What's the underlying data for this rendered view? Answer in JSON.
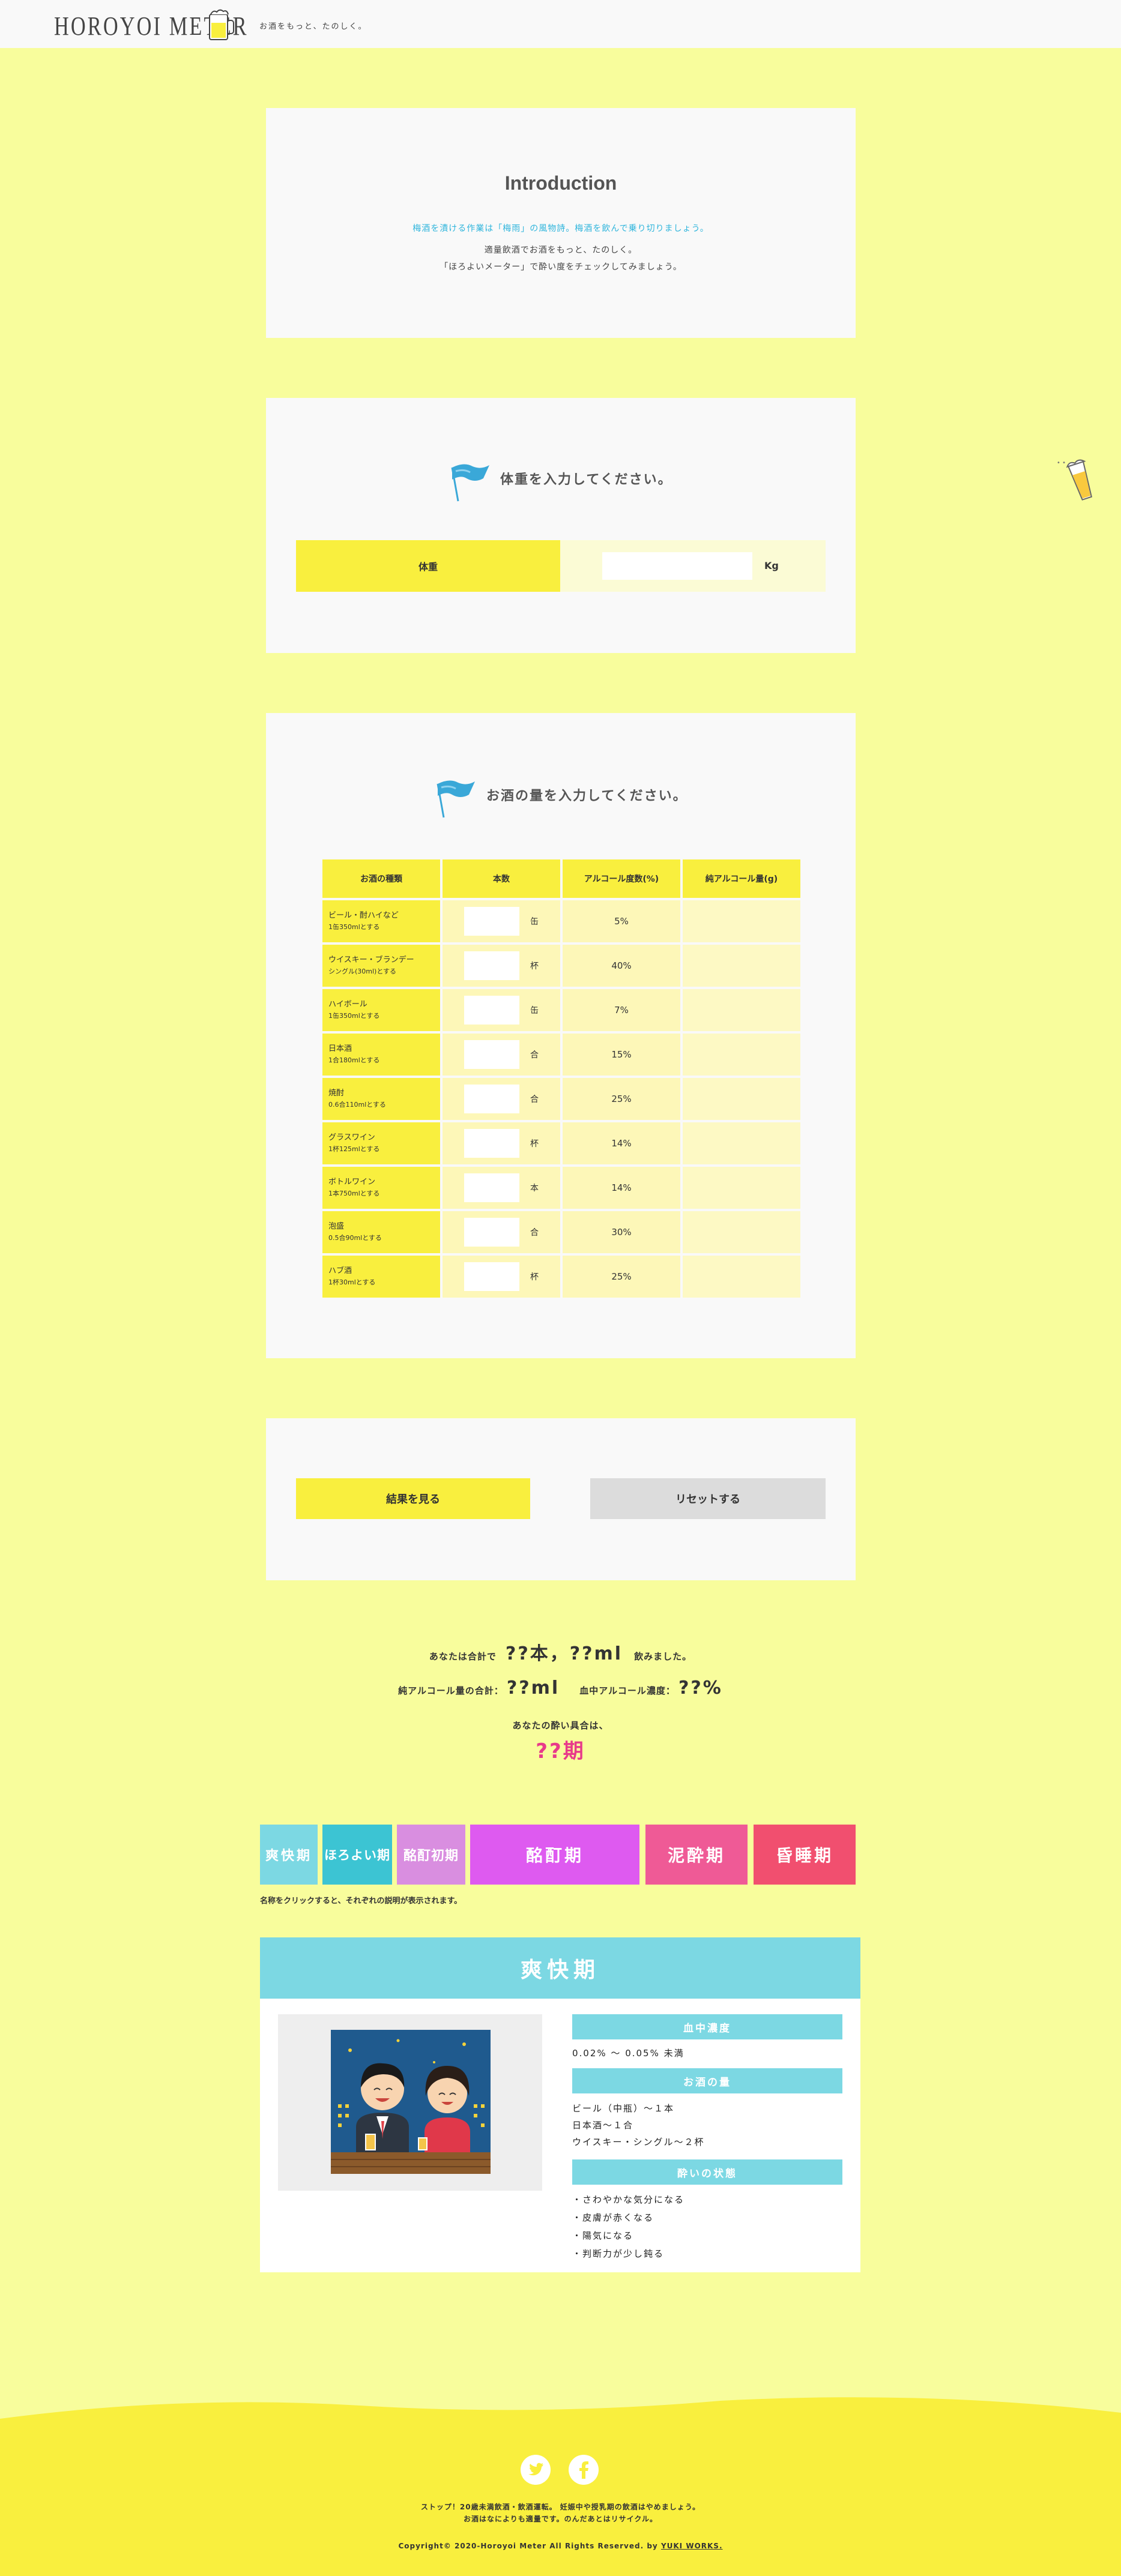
{
  "header": {
    "logo": "HOROYOI METER",
    "tagline": "お酒をもっと、たのしく。"
  },
  "intro": {
    "title": "Introduction",
    "lead": "梅酒を漬ける作業は「梅雨」の風物詩。梅酒を飲んで乗り切りましょう。",
    "body1": "適量飲酒でお酒をもっと、たのしく。",
    "body2": "「ほろよいメーター」で酔い度をチェックしてみましょう。"
  },
  "weight": {
    "heading": "体重を入力してください。",
    "label": "体重",
    "value": "",
    "unit": "Kg"
  },
  "drinks": {
    "heading": "お酒の量を入力してください。",
    "headers": [
      "お酒の種類",
      "本数",
      "アルコール度数(%)",
      "純アルコール量(g)"
    ],
    "rows": [
      {
        "name": "ビール・酎ハイなど",
        "note": "1缶350mlとする",
        "unit": "缶",
        "degree": "5%"
      },
      {
        "name": "ウイスキー・ブランデー",
        "note": "シングル(30ml)とする",
        "unit": "杯",
        "degree": "40%"
      },
      {
        "name": "ハイボール",
        "note": "1缶350mlとする",
        "unit": "缶",
        "degree": "7%"
      },
      {
        "name": "日本酒",
        "note": "1合180mlとする",
        "unit": "合",
        "degree": "15%"
      },
      {
        "name": "焼酎",
        "note": "0.6合110mlとする",
        "unit": "合",
        "degree": "25%"
      },
      {
        "name": "グラスワイン",
        "note": "1杯125mlとする",
        "unit": "杯",
        "degree": "14%"
      },
      {
        "name": "ボトルワイン",
        "note": "1本750mlとする",
        "unit": "本",
        "degree": "14%"
      },
      {
        "name": "泡盛",
        "note": "0.5合90mlとする",
        "unit": "合",
        "degree": "30%"
      },
      {
        "name": "ハブ酒",
        "note": "1杯30mlとする",
        "unit": "杯",
        "degree": "25%"
      }
    ]
  },
  "buttons": {
    "result": "結果を見る",
    "reset": "リセットする"
  },
  "result": {
    "total_prefix": "あなたは合計で",
    "total_value": "??本，??ml",
    "total_suffix": "飲みました。",
    "pure_label": "純アルコール量の合計：",
    "pure_value": "??ml",
    "blood_label": "血中アルコール濃度：",
    "blood_value": "??%",
    "stage_label": "あなたの酔い具合は、",
    "stage_value": "??期"
  },
  "stages": [
    {
      "label": "爽快期",
      "color": "#7cd8e3"
    },
    {
      "label": "ほろよい期",
      "color": "#3cc4d3"
    },
    {
      "label": "酩酊初期",
      "color": "#d98ee0"
    },
    {
      "label": "酩酊期",
      "color": "#de5af0"
    },
    {
      "label": "泥酔期",
      "color": "#ef5a96"
    },
    {
      "label": "昏睡期",
      "color": "#f14f6f"
    }
  ],
  "stage_note": "名称をクリックすると、それぞれの説明が表示されます。",
  "detail": {
    "title": "爽快期",
    "blood_label": "血中濃度",
    "blood_text": "0.02% 〜 0.05% 未満",
    "amount_label": "お酒の量",
    "amount_lines": [
      "ビール（中瓶）〜１本",
      "日本酒〜１合",
      "ウイスキー・シングル〜２杯"
    ],
    "state_label": "酔いの状態",
    "state_lines": [
      "・さわやかな気分になる",
      "・皮膚が赤くなる",
      "・陽気になる",
      "・判断力が少し鈍る"
    ]
  },
  "footer": {
    "warning1": "ストップ！20歳未満飲酒・飲酒運転。 妊娠中や授乳期の飲酒はやめましょう。",
    "warning2": "お酒はなによりも適量です。のんだあとはリサイクル。",
    "copyright": "Copyright© 2020-Horoyoi Meter All Rights Reserved. by",
    "credit": "YUKI WORKS."
  }
}
